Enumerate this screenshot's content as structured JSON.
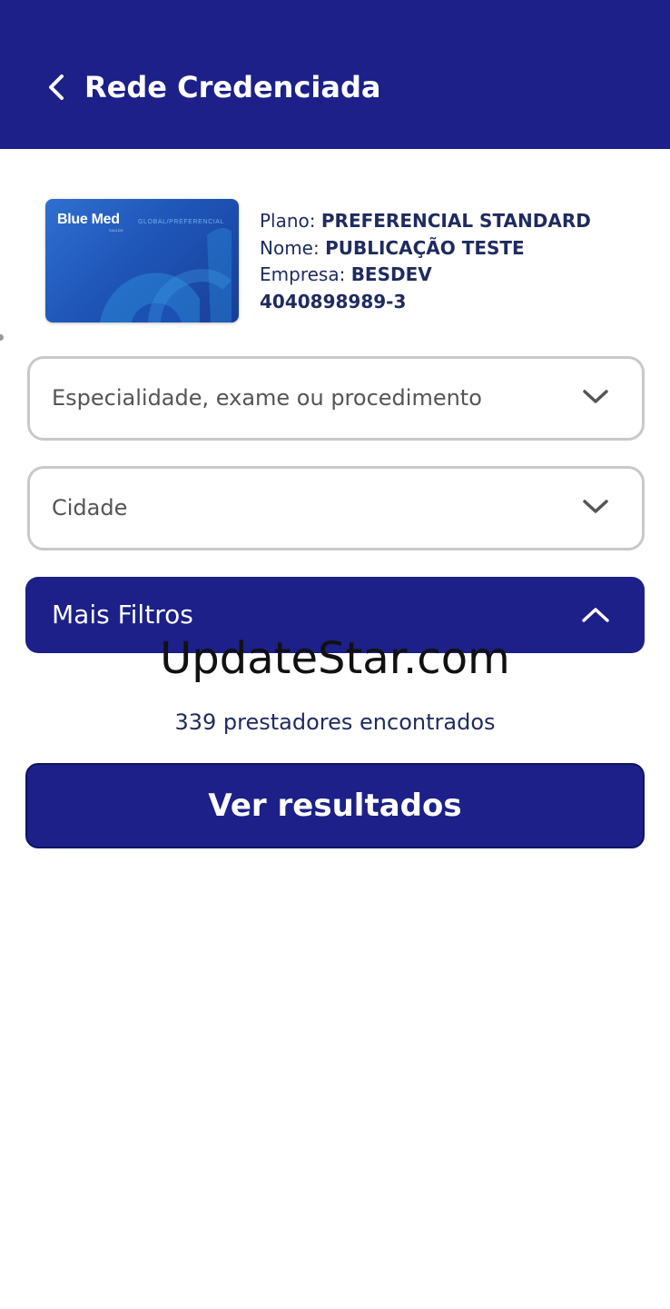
{
  "header": {
    "title": "Rede Credenciada",
    "back_icon": "chevron-left-icon"
  },
  "card": {
    "brand": "Blue Med",
    "brand_sub": "GLOBAL/PREFERENCIAL",
    "brand_tiny": "SAÚDE"
  },
  "member": {
    "plan_label": "Plano:",
    "plan_value": "PREFERENCIAL STANDARD",
    "name_label": "Nome:",
    "name_value": "PUBLICAÇÃO TESTE",
    "company_label": "Empresa:",
    "company_value": "BESDEV",
    "card_number": "4040898989-3"
  },
  "filters": {
    "specialty_placeholder": "Especialidade, exame ou procedimento",
    "city_placeholder": "Cidade",
    "more_filters_label": "Mais Filtros"
  },
  "watermark": "UpdateStar.com",
  "results": {
    "count_text": "339 prestadores encontrados",
    "button_label": "Ver resultados"
  },
  "colors": {
    "primary": "#1c2088",
    "text_dark": "#1f2b5e",
    "border": "#c9c9c9"
  }
}
